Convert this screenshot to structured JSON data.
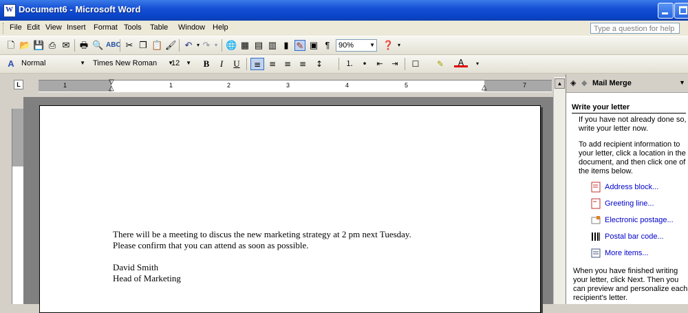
{
  "window": {
    "title": "Document6 - Microsoft Word",
    "icon_letter": "W"
  },
  "menu": {
    "items": [
      {
        "label": "File"
      },
      {
        "label": "Edit"
      },
      {
        "label": "View"
      },
      {
        "label": "Insert"
      },
      {
        "label": "Format"
      },
      {
        "label": "Tools"
      },
      {
        "label": "Table"
      },
      {
        "label": "Window"
      },
      {
        "label": "Help"
      }
    ],
    "help_placeholder": "Type a question for help"
  },
  "standard_toolbar": {
    "zoom": "90%"
  },
  "formatting_toolbar": {
    "style": "Normal",
    "font": "Times New Roman",
    "size": "12"
  },
  "ruler": {
    "numbers": [
      "1",
      "1",
      "2",
      "3",
      "4",
      "5",
      "7"
    ]
  },
  "document": {
    "paragraph1_line1": "There will be a meeting to discus the new marketing strategy at 2 pm next Tuesday.",
    "paragraph1_line2": "Please confirm that you can attend as soon as possible.",
    "signature_name": "David Smith",
    "signature_title": "Head of Marketing"
  },
  "task_pane": {
    "title": "Mail Merge",
    "section_heading": "Write your letter",
    "intro_lines": [
      "If you have not already done so,",
      "write your letter now."
    ],
    "instructions_lines": [
      "To add recipient information to",
      "your letter, click a location in the",
      "document, and then click one of",
      "the items below."
    ],
    "links": [
      {
        "label": "Address block...",
        "icon": "address-block-icon"
      },
      {
        "label": "Greeting line...",
        "icon": "greeting-line-icon"
      },
      {
        "label": "Electronic postage...",
        "icon": "postage-icon"
      },
      {
        "label": "Postal bar code...",
        "icon": "barcode-icon"
      },
      {
        "label": "More items...",
        "icon": "more-items-icon"
      }
    ],
    "footer_lines": [
      "When you have finished writing",
      "your letter, click Next. Then you",
      "can preview and personalize each",
      "recipient's letter."
    ]
  },
  "colors": {
    "titlebar": "#0a44c8",
    "link": "#0000cc",
    "doc_background": "#808080"
  }
}
